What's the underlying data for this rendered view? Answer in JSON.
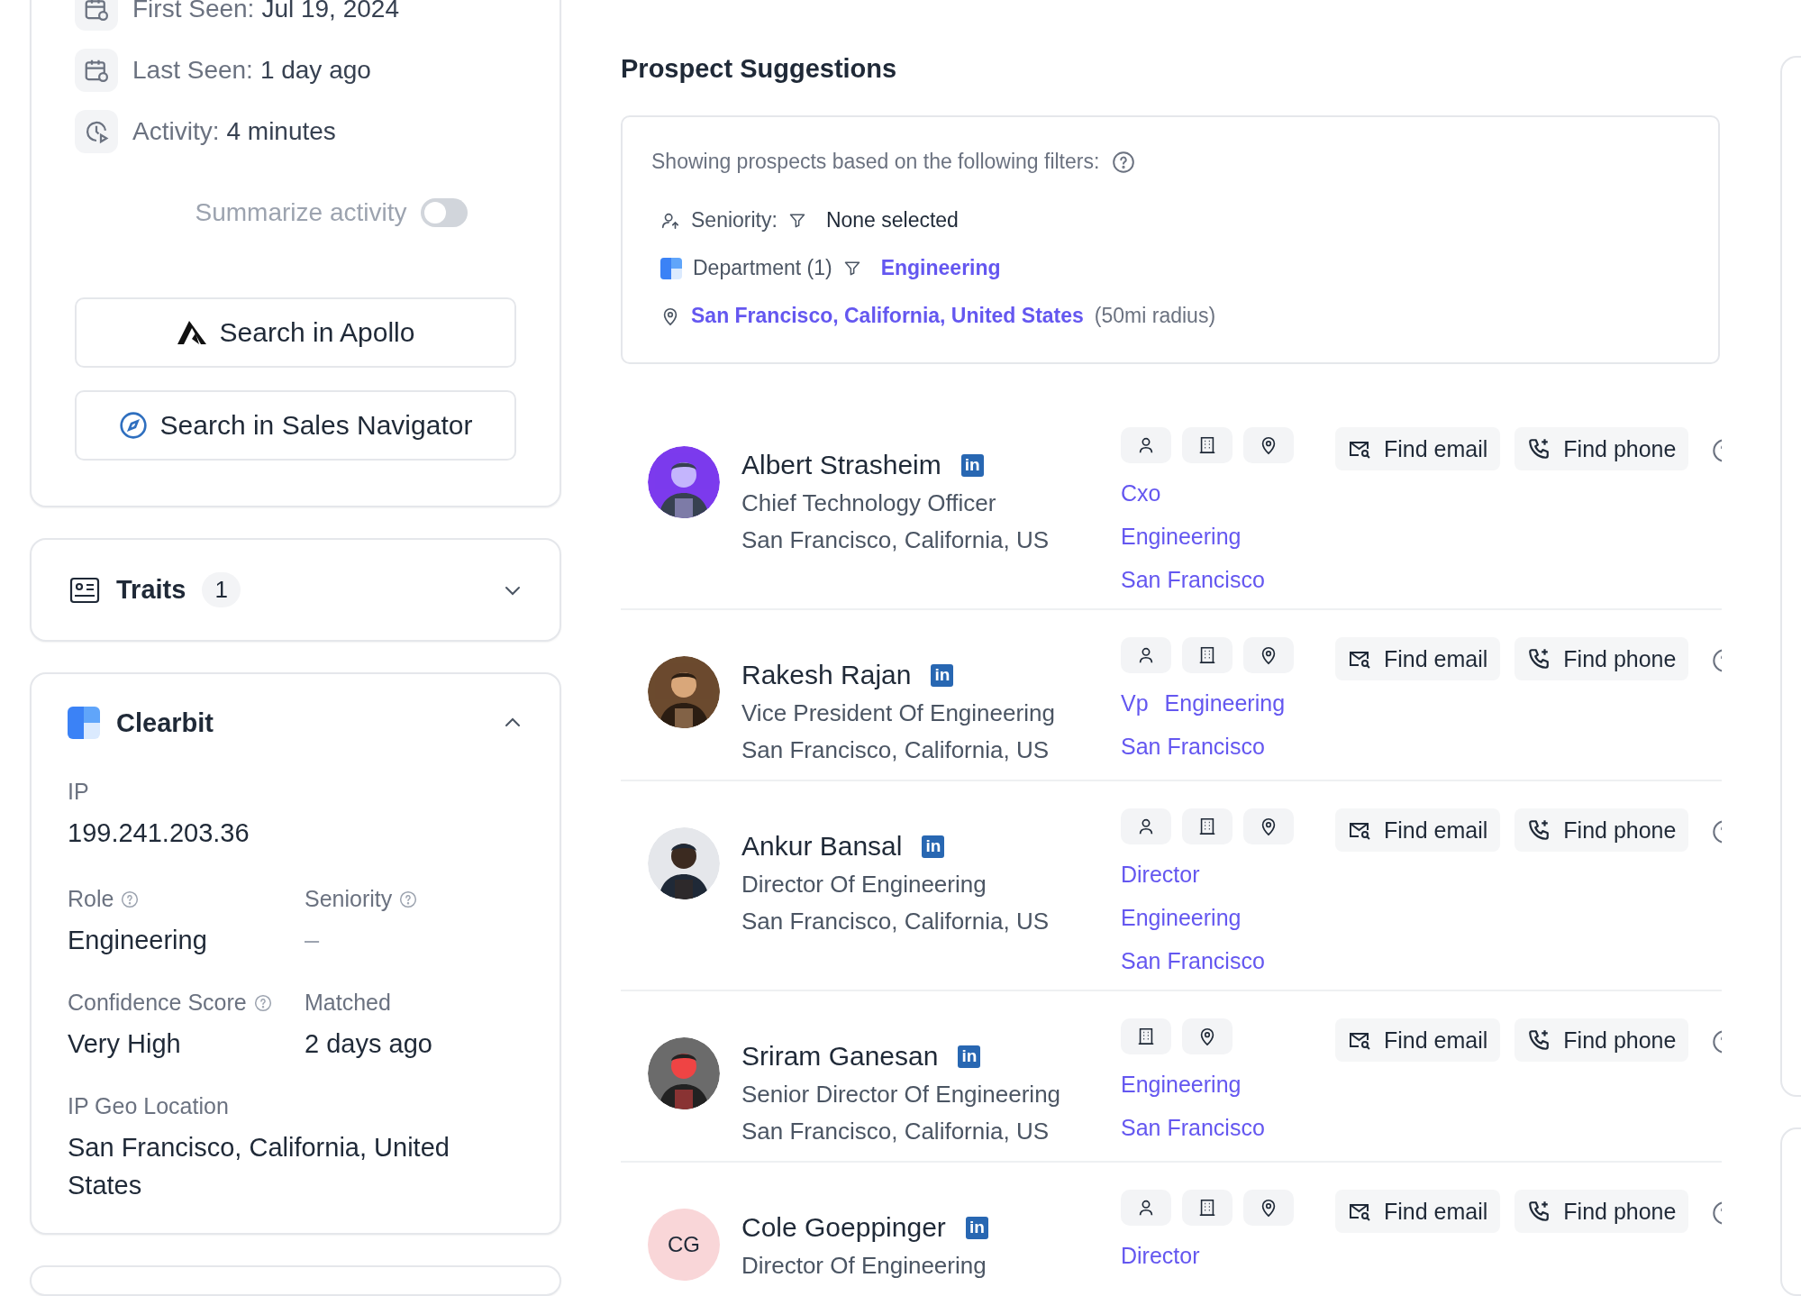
{
  "activity_card": {
    "items": [
      {
        "kind": "calendar",
        "label": "First Seen:",
        "value": "Jul 19, 2024"
      },
      {
        "kind": "calendar",
        "label": "Last Seen:",
        "value": "1 day ago"
      },
      {
        "kind": "clock",
        "label": "Activity:",
        "value": "4 minutes"
      }
    ],
    "summarize": {
      "label": "Summarize activity",
      "on": false
    },
    "buttons": [
      {
        "kind": "apollo",
        "label": "Search in Apollo"
      },
      {
        "kind": "compass",
        "label": "Search in Sales Navigator"
      }
    ]
  },
  "traits": {
    "title": "Traits",
    "count": "1",
    "expanded": false
  },
  "clearbit": {
    "title": "Clearbit",
    "expanded": true,
    "ip_label": "IP",
    "ip": "199.241.203.36",
    "fields": [
      {
        "label": "Role",
        "help": true,
        "value": "Engineering",
        "muted": false
      },
      {
        "label": "Seniority",
        "help": true,
        "value": "–",
        "muted": true
      },
      {
        "label": "Confidence Score",
        "help": true,
        "value": "Very High",
        "muted": false
      },
      {
        "label": "Matched",
        "help": false,
        "value": "2 days ago",
        "muted": false
      }
    ],
    "geo_label": "IP Geo Location",
    "geo": "San Francisco, California, United States"
  },
  "prospects": {
    "title": "Prospect Suggestions",
    "filters": {
      "intro": "Showing prospects based on the following filters:",
      "rows": [
        {
          "kind": "seniority",
          "label": "Seniority:",
          "filter": true,
          "value": "None selected",
          "highlight": false
        },
        {
          "kind": "department",
          "label": "Department (1)",
          "filter": true,
          "value": "Engineering",
          "highlight": true
        },
        {
          "kind": "location",
          "filter": false,
          "value": "San Francisco, California, United States",
          "highlight": true,
          "note": "(50mi radius)"
        }
      ]
    },
    "items": [
      {
        "name": "Albert Strasheim",
        "badge": "in",
        "title": "Chief Technology Officer",
        "location": "San Francisco, California, US",
        "avatar": {
          "kind": "picture"
        },
        "tag_icons": [
          {
            "kind": "person"
          },
          {
            "kind": "building"
          },
          {
            "kind": "pin"
          }
        ],
        "tag_lines": [
          [
            "Cxo"
          ],
          [
            "Engineering"
          ],
          [
            "San Francisco"
          ]
        ],
        "actions": [
          {
            "kind": "email",
            "label": "Find email"
          },
          {
            "kind": "phone",
            "label": "Find phone"
          }
        ]
      },
      {
        "name": "Rakesh Rajan",
        "badge": "in",
        "title": "Vice President Of Engineering",
        "location": "San Francisco, California, US",
        "avatar": {
          "kind": "picture"
        },
        "tag_icons": [
          {
            "kind": "person"
          },
          {
            "kind": "building"
          },
          {
            "kind": "pin"
          }
        ],
        "tag_lines": [
          [
            "Vp",
            "Engineering"
          ],
          [
            "San Francisco"
          ]
        ],
        "actions": [
          {
            "kind": "email",
            "label": "Find email"
          },
          {
            "kind": "phone",
            "label": "Find phone"
          }
        ]
      },
      {
        "name": "Ankur Bansal",
        "badge": "in",
        "title": "Director Of Engineering",
        "location": "San Francisco, California, US",
        "avatar": {
          "kind": "picture"
        },
        "tag_icons": [
          {
            "kind": "person"
          },
          {
            "kind": "building"
          },
          {
            "kind": "pin"
          }
        ],
        "tag_lines": [
          [
            "Director"
          ],
          [
            "Engineering"
          ],
          [
            "San Francisco"
          ]
        ],
        "actions": [
          {
            "kind": "email",
            "label": "Find email"
          },
          {
            "kind": "phone",
            "label": "Find phone"
          }
        ]
      },
      {
        "name": "Sriram Ganesan",
        "badge": "in",
        "title": "Senior Director Of Engineering",
        "location": "San Francisco, California, US",
        "avatar": {
          "kind": "picture"
        },
        "tag_icons": [
          {
            "kind": "building"
          },
          {
            "kind": "pin"
          }
        ],
        "tag_lines": [
          [
            "Engineering"
          ],
          [
            "San Francisco"
          ]
        ],
        "actions": [
          {
            "kind": "email",
            "label": "Find email"
          },
          {
            "kind": "phone",
            "label": "Find phone"
          }
        ]
      },
      {
        "name": "Cole Goeppinger",
        "badge": "in",
        "title": "Director Of Engineering",
        "avatar": {
          "kind": "initials",
          "text": "CG"
        },
        "tag_icons": [
          {
            "kind": "person"
          },
          {
            "kind": "building"
          },
          {
            "kind": "pin"
          }
        ],
        "tag_lines": [
          [
            "Director"
          ]
        ],
        "actions": [
          {
            "kind": "email",
            "label": "Find email"
          },
          {
            "kind": "phone",
            "label": "Find phone"
          }
        ]
      }
    ]
  }
}
